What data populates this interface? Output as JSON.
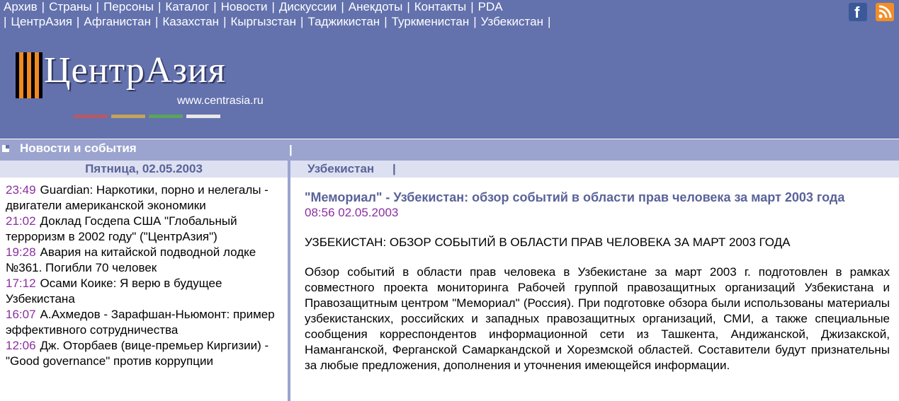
{
  "nav": {
    "top": [
      "Архив",
      "Страны",
      "Персоны",
      "Каталог",
      "Новости",
      "Дискуссии",
      "Анекдоты",
      "Контакты",
      "PDA"
    ],
    "countries": [
      "ЦентрАзия",
      "Афганистан",
      "Казахстан",
      "Кыргызстан",
      "Таджикистан",
      "Туркменистан",
      "Узбекистан"
    ]
  },
  "logo": {
    "name": "ЦентрАзия",
    "url": "www.centrasia.ru"
  },
  "colors": {
    "header": "#6371ad",
    "section_bar": "#9ba4cf",
    "sub_bar": "#dde0f0",
    "time": "#8b2fa0",
    "title": "#5a6399"
  },
  "social": {
    "facebook_icon": "facebook-icon",
    "rss_icon": "rss-icon"
  },
  "section": {
    "title": "Новости и события",
    "pipe": "|"
  },
  "date_header": "Пятница, 02.05.2003",
  "category": {
    "name": "Узбекистан",
    "pipe": "|"
  },
  "news": [
    {
      "time": "23:49",
      "text": "Guardian: Наркотики, порно и нелегалы - двигатели американской экономики"
    },
    {
      "time": "21:02",
      "text": "Доклад Госдепа США \"Глобальный терроризм в 2002 году\" (\"ЦентрАзия\")"
    },
    {
      "time": "19:28",
      "text": "Авария на китайской подводной лодке №361. Погибли 70 человек"
    },
    {
      "time": "17:12",
      "text": "Осами Коике: Я верю в будущее Узбекистана"
    },
    {
      "time": "16:07",
      "text": "А.Ахмедов - Зарафшан-Ньюмонт: пример эффективного сотрудничества"
    },
    {
      "time": "12:06",
      "text": "Дж. Оторбаев (вице-премьер Киргизии) - \"Good governance\" против коррупции"
    }
  ],
  "article": {
    "title": "\"Мемориал\" - Узбекистан: обзор событий в области прав человека за март 2003 года",
    "datetime": "08:56 02.05.2003",
    "heading": "УЗБЕКИСТАН: ОБЗОР СОБЫТИЙ В ОБЛАСТИ ПРАВ ЧЕЛОВЕКА ЗА МАРТ 2003 ГОДА",
    "body": "Обзор событий в области прав человека в Узбекистане за март 2003 г. подготовлен в рамках совместного проекта мониторинга Рабочей группой правозащитных организаций Узбекистана и Правозащитным центром \"Мемориал\" (Россия). При подготовке обзора были использованы материалы узбекистанских, российских и западных правозащитных организаций, СМИ, а также специальные сообщения корреспондентов информационной сети из Ташкента, Андижанской, Джизакской, Наманганской, Ферганской Самаркандской и Хорезмской областей. Составители будут признательны за любые предложения, дополнения и уточнения имеющейся информации."
  }
}
